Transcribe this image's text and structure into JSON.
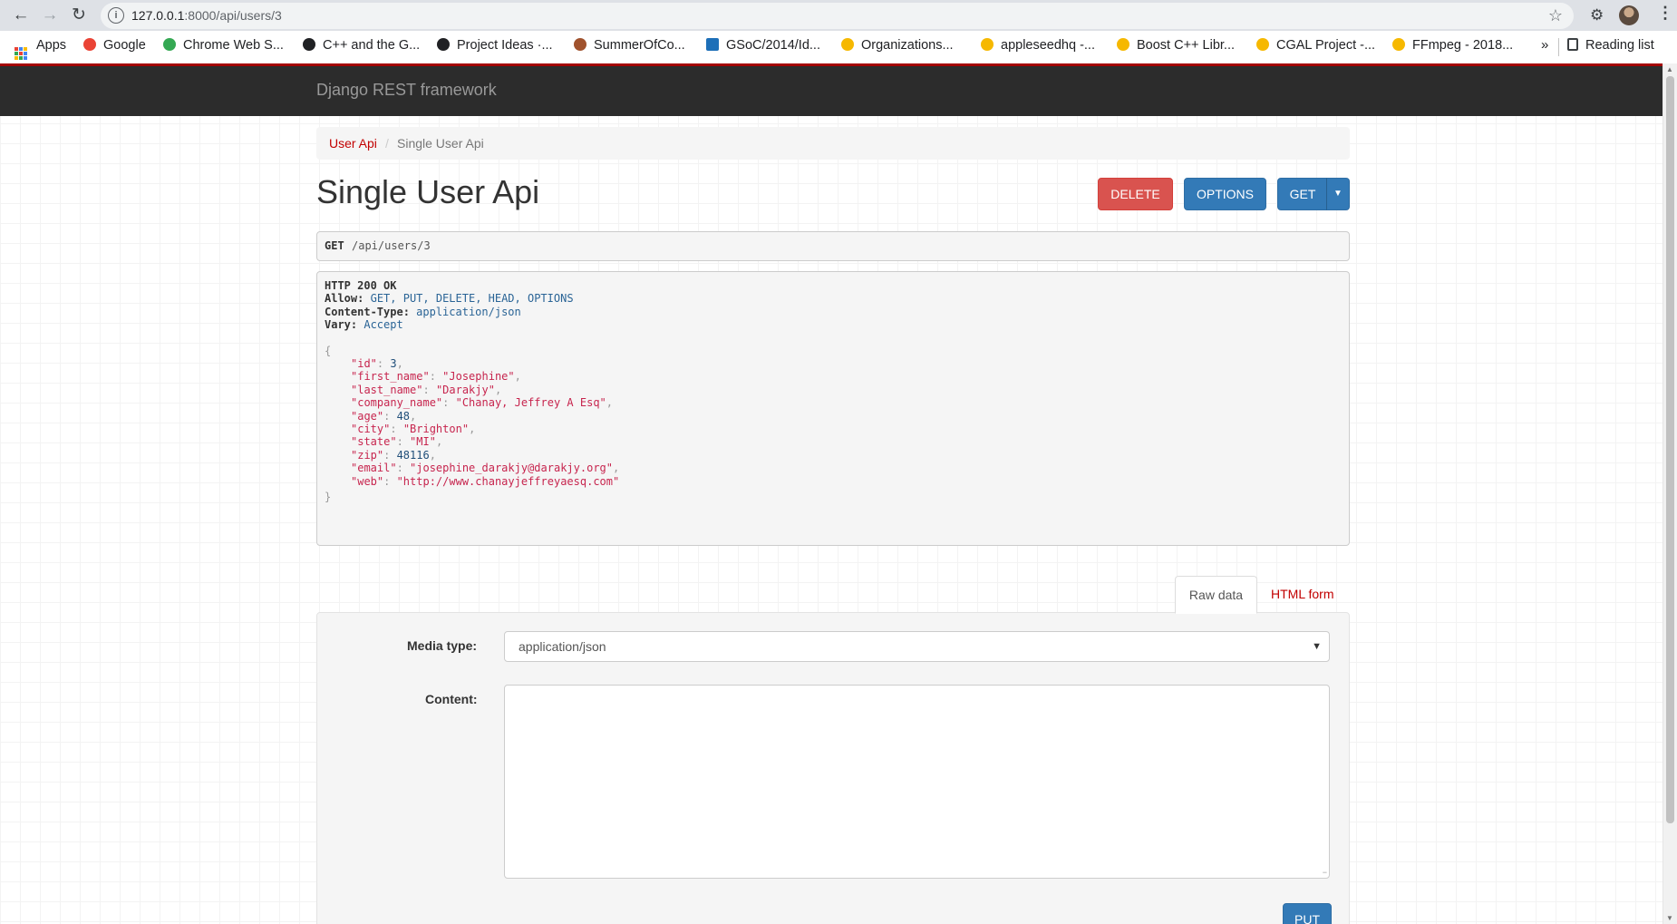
{
  "browser": {
    "url_host": "127.0.0.1",
    "url_rest": ":8000/api/users/3",
    "bookmarks": [
      {
        "label": "Apps",
        "color": "#4285f4"
      },
      {
        "label": "Google",
        "color": "#ea4335"
      },
      {
        "label": "Chrome Web S...",
        "color": "#34a853"
      },
      {
        "label": "C++ and the G...",
        "color": "#202124"
      },
      {
        "label": "Project Ideas ·...",
        "color": "#202124"
      },
      {
        "label": "SummerOfCo...",
        "color": "#a0522d"
      },
      {
        "label": "GSoC/2014/Id...",
        "color": "#1d6fb8"
      },
      {
        "label": "Organizations...",
        "color": "#f6b800"
      },
      {
        "label": "appleseedhq -...",
        "color": "#f6b800"
      },
      {
        "label": "Boost C++ Libr...",
        "color": "#f6b800"
      },
      {
        "label": "CGAL Project -...",
        "color": "#f6b800"
      },
      {
        "label": "FFmpeg - 2018...",
        "color": "#f6b800"
      }
    ],
    "more": "»",
    "reading_list": "Reading list"
  },
  "navbar": {
    "brand": "Django REST framework"
  },
  "breadcrumb": {
    "parent": "User Api",
    "separator": "/",
    "current": "Single User Api"
  },
  "title": "Single User Api",
  "actions": {
    "delete": "DELETE",
    "options": "OPTIONS",
    "get": "GET"
  },
  "request": {
    "method": "GET",
    "path": "/api/users/3"
  },
  "response": {
    "status": "HTTP 200 OK",
    "headers": [
      {
        "key": "Allow:",
        "value": "GET, PUT, DELETE, HEAD, OPTIONS"
      },
      {
        "key": "Content-Type:",
        "value": "application/json"
      },
      {
        "key": "Vary:",
        "value": "Accept"
      }
    ],
    "open_brace": "{",
    "close_brace": "}",
    "body": [
      {
        "key": "\"id\"",
        "value": "3",
        "kind": "num",
        "comma": ","
      },
      {
        "key": "\"first_name\"",
        "value": "\"Josephine\"",
        "kind": "str",
        "comma": ","
      },
      {
        "key": "\"last_name\"",
        "value": "\"Darakjy\"",
        "kind": "str",
        "comma": ","
      },
      {
        "key": "\"company_name\"",
        "value": "\"Chanay, Jeffrey A Esq\"",
        "kind": "str",
        "comma": ","
      },
      {
        "key": "\"age\"",
        "value": "48",
        "kind": "num",
        "comma": ","
      },
      {
        "key": "\"city\"",
        "value": "\"Brighton\"",
        "kind": "str",
        "comma": ","
      },
      {
        "key": "\"state\"",
        "value": "\"MI\"",
        "kind": "str",
        "comma": ","
      },
      {
        "key": "\"zip\"",
        "value": "48116",
        "kind": "num",
        "comma": ","
      },
      {
        "key": "\"email\"",
        "value": "\"josephine_darakjy@darakjy.org\"",
        "kind": "str",
        "comma": ","
      },
      {
        "key": "\"web\"",
        "value": "\"http://www.chanayjeffreyaesq.com\"",
        "kind": "str",
        "comma": ""
      }
    ]
  },
  "form": {
    "tabs": {
      "raw": "Raw data",
      "html": "HTML form"
    },
    "media_type_label": "Media type:",
    "media_type_value": "application/json",
    "content_label": "Content:",
    "content_value": "",
    "put": "PUT"
  },
  "colors": {
    "accent": "#c20000",
    "primary": "#337ab7",
    "danger": "#d9534f",
    "navbar": "#2c2c2c"
  }
}
